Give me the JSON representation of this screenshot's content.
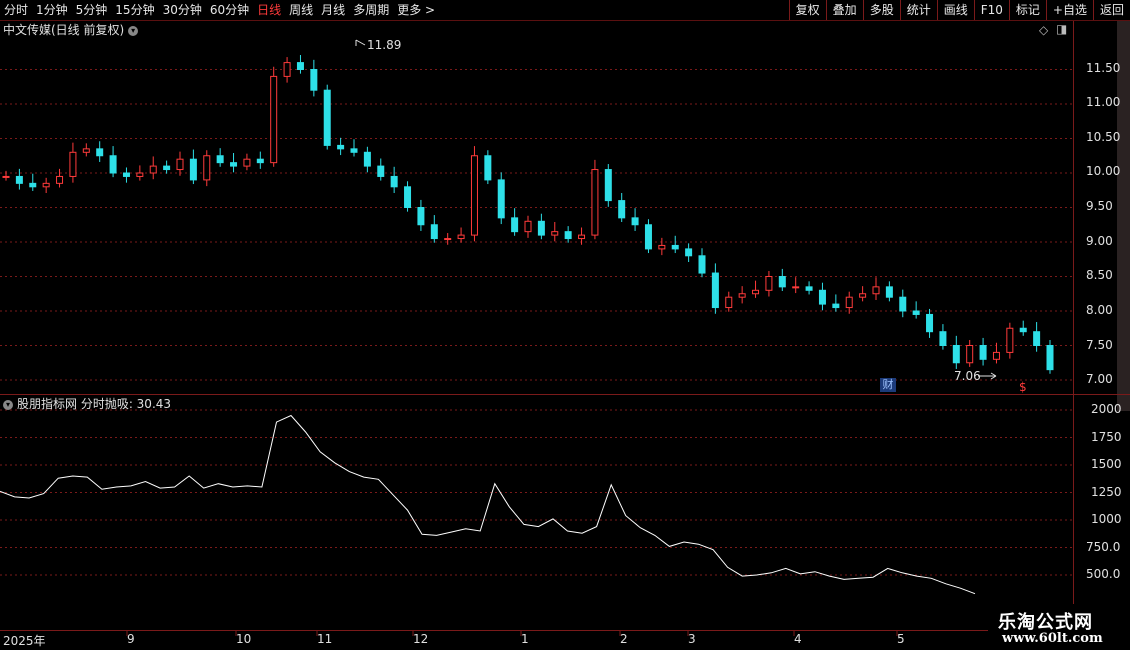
{
  "toolbar": {
    "periods": [
      "分时",
      "1分钟",
      "5分钟",
      "15分钟",
      "30分钟",
      "60分钟",
      "日线",
      "周线",
      "月线",
      "多周期",
      "更多 >"
    ],
    "active_period": "日线",
    "actions": [
      "复权",
      "叠加",
      "多股",
      "统计",
      "画线",
      "F10",
      "标记",
      "+自选",
      "返回"
    ]
  },
  "main_panel": {
    "title": "中文传媒(日线 前复权)",
    "y_ticks": [
      "11.50",
      "11.00",
      "10.50",
      "10.00",
      "9.50",
      "9.00",
      "8.50",
      "8.00",
      "7.50",
      "7.00"
    ],
    "high_label": "11.89",
    "low_label": "7.06",
    "badge_cai": "财",
    "badge_s": "$"
  },
  "sub_panel": {
    "title": "股朋指标网 分时抛吸: 30.43",
    "y_ticks": [
      "2000",
      "1750",
      "1500",
      "1250",
      "1000",
      "750.0",
      "500.0"
    ]
  },
  "x_axis": {
    "labels": [
      "2025年",
      "9",
      "10",
      "11",
      "12",
      "1",
      "2",
      "3",
      "4",
      "5"
    ]
  },
  "watermark": {
    "line1": "乐淘公式网",
    "line2": "www.60lt.com"
  },
  "colors": {
    "up": "#ff3b3b",
    "down": "#2ee0e8",
    "grid": "#7a1a1a",
    "line": "#ffffff"
  },
  "chart_data": [
    {
      "type": "candlestick",
      "title": "中文传媒(日线 前复权)",
      "ylim": [
        7.0,
        11.9
      ],
      "series": [
        {
          "name": "close",
          "values": [
            9.95,
            9.85,
            9.8,
            9.85,
            9.95,
            10.3,
            10.35,
            10.25,
            10.0,
            9.95,
            10.0,
            10.1,
            10.05,
            10.2,
            9.9,
            10.25,
            10.15,
            10.1,
            10.2,
            10.15,
            11.4,
            11.6,
            11.5,
            11.2,
            10.4,
            10.35,
            10.3,
            10.1,
            9.95,
            9.8,
            9.5,
            9.25,
            9.05,
            9.05,
            9.1,
            10.25,
            9.9,
            9.35,
            9.15,
            9.3,
            9.1,
            9.15,
            9.05,
            9.1,
            10.05,
            9.6,
            9.35,
            9.25,
            8.9,
            8.95,
            8.9,
            8.8,
            8.55,
            8.05,
            8.2,
            8.25,
            8.3,
            8.5,
            8.35,
            8.35,
            8.3,
            8.1,
            8.05,
            8.2,
            8.25,
            8.35,
            8.2,
            8.0,
            7.95,
            7.7,
            7.5,
            7.25,
            7.5,
            7.3,
            7.4,
            7.75,
            7.7,
            7.5,
            7.15
          ]
        }
      ]
    },
    {
      "type": "line",
      "title": "股朋指标网 分时抛吸",
      "ylim": [
        300,
        2050
      ],
      "series": [
        {
          "name": "分时抛吸",
          "values": [
            1260,
            1210,
            1200,
            1240,
            1380,
            1400,
            1390,
            1280,
            1300,
            1310,
            1350,
            1290,
            1300,
            1400,
            1290,
            1330,
            1300,
            1310,
            1300,
            1890,
            1950,
            1800,
            1620,
            1520,
            1440,
            1390,
            1370,
            1230,
            1090,
            870,
            860,
            890,
            920,
            900,
            1330,
            1120,
            960,
            940,
            1010,
            900,
            880,
            940,
            1320,
            1040,
            930,
            860,
            760,
            800,
            780,
            730,
            570,
            490,
            500,
            520,
            560,
            510,
            530,
            490,
            460,
            470,
            480,
            560,
            520,
            490,
            470,
            420,
            380,
            330
          ]
        }
      ]
    }
  ]
}
